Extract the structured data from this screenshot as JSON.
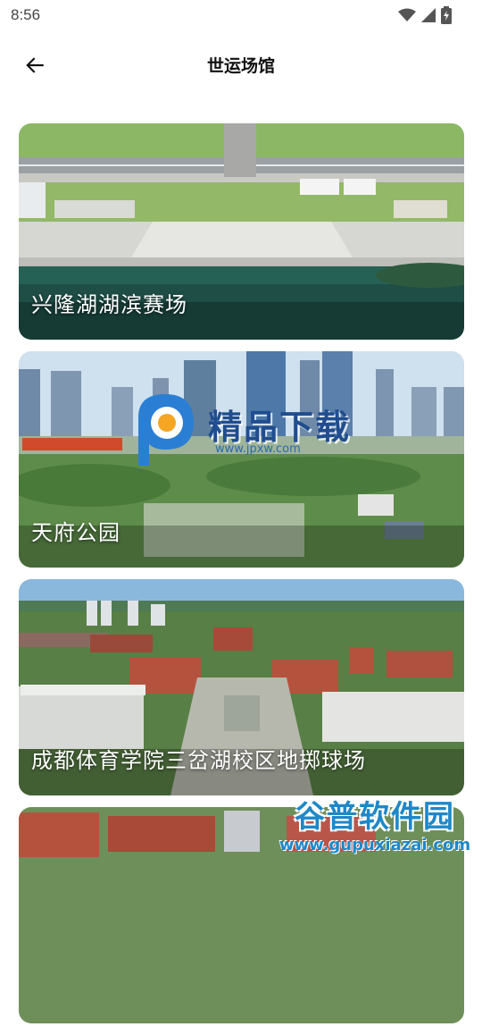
{
  "status_bar": {
    "time": "8:56",
    "icons": [
      "wifi-icon",
      "signal-icon",
      "battery-charging-icon"
    ]
  },
  "header": {
    "back_icon": "arrow-left-icon",
    "title": "世运场馆"
  },
  "venues": [
    {
      "name": "兴隆湖湖滨赛场"
    },
    {
      "name": "天府公园"
    },
    {
      "name": "成都体育学院三岔湖校区地掷球场"
    },
    {
      "name": ""
    }
  ],
  "overlay_logo": {
    "text": "精品下载",
    "url": "www.jpxw.com"
  },
  "watermark": {
    "title": "谷普软件园",
    "url": "www.gupuxiazai.com"
  },
  "colors": {
    "brand_blue": "#1e88c8",
    "card_name_text": "#ffffff"
  }
}
